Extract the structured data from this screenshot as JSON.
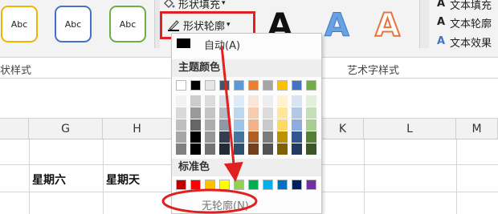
{
  "ribbon": {
    "shape_styles": [
      "Abc",
      "Abc",
      "Abc"
    ],
    "shape_fill": "形状填充",
    "shape_outline": "形状轮廓",
    "wordart": [
      "A",
      "A",
      "A"
    ],
    "text_fill": "文本填充",
    "text_outline": "文本轮廓",
    "text_effect": "文本效果",
    "groups": {
      "shape_styles": "状样式",
      "wordart_styles": "艺术字样式"
    }
  },
  "sheet": {
    "columns": [
      "G",
      "H",
      "K",
      "L",
      "M"
    ],
    "cells": [
      "星期六",
      "星期天"
    ]
  },
  "dropdown": {
    "automatic": "自动(A)",
    "theme_colors_label": "主题颜色",
    "theme_colors": [
      "#ffffff",
      "#000000",
      "#e7e6e6",
      "#44546a",
      "#5b9bd5",
      "#ed7d31",
      "#a5a5a5",
      "#ffc000",
      "#4472c4",
      "#70ad47"
    ],
    "standard_colors_label": "标准色",
    "standard_colors": [
      "#c00000",
      "#ff0000",
      "#ffc000",
      "#ffff00",
      "#92d050",
      "#00b050",
      "#00b0f0",
      "#0070c0",
      "#002060",
      "#7030a0"
    ],
    "no_outline": "无轮廓(N)"
  },
  "colors": {
    "annotation": "#e0211f"
  }
}
